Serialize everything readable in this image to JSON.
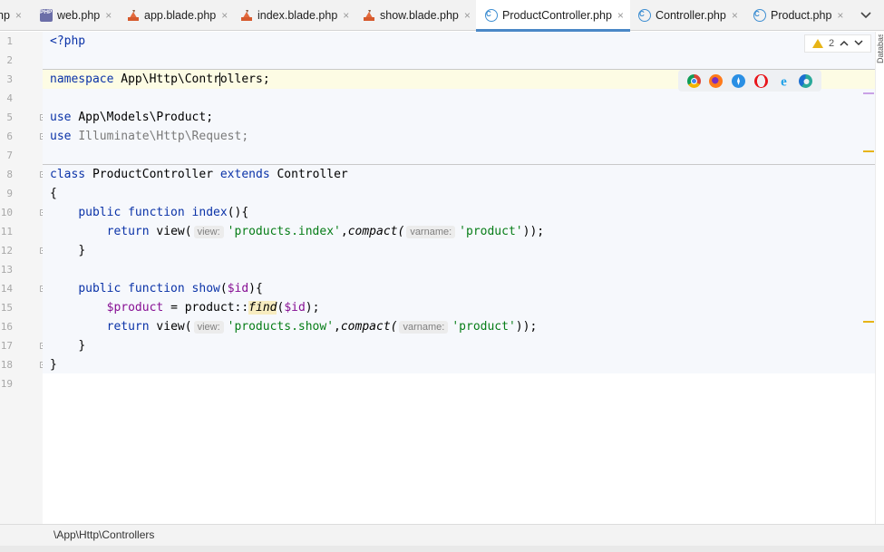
{
  "tabs": [
    {
      "label": "hp",
      "icon": "php-file-icon",
      "active": false
    },
    {
      "label": "web.php",
      "icon": "php-file-icon",
      "active": false
    },
    {
      "label": "app.blade.php",
      "icon": "blade-file-icon",
      "active": false
    },
    {
      "label": "index.blade.php",
      "icon": "blade-file-icon",
      "active": false
    },
    {
      "label": "show.blade.php",
      "icon": "blade-file-icon",
      "active": false
    },
    {
      "label": "ProductController.php",
      "icon": "class-icon",
      "active": true
    },
    {
      "label": "Controller.php",
      "icon": "class-icon",
      "active": false
    },
    {
      "label": "Product.php",
      "icon": "class-icon",
      "active": false
    }
  ],
  "tab_close_glyph": "×",
  "php_badge": "PHP",
  "class_badge": "C",
  "inspection": {
    "warning_count": "2",
    "icon": "warning-icon"
  },
  "line_numbers": [
    "1",
    "2",
    "3",
    "4",
    "5",
    "6",
    "7",
    "8",
    "9",
    "10",
    "11",
    "12",
    "13",
    "14",
    "15",
    "16",
    "17",
    "18",
    "19"
  ],
  "code": {
    "l1": "<?php",
    "l3_kw": "namespace",
    "l3_pre": "App\\Http\\Contr",
    "l3_post": "ollers",
    "l3_end": ";",
    "l5_kw": "use",
    "l5_rest": "App\\Models\\Product;",
    "l6_kw": "use",
    "l6_rest": "Illuminate\\Http\\Request;",
    "l8_kw1": "class",
    "l8_name": "ProductController",
    "l8_kw2": "extends",
    "l8_parent": "Controller",
    "l9": "{",
    "l10_kw": "public function",
    "l10_fn": "index",
    "l10_end": "(){",
    "l11_kw": "return",
    "l11_fn": "view(",
    "l11_hint1": "view:",
    "l11_str1": "'products.index'",
    "l11_comma": ",",
    "l11_compact": "compact(",
    "l11_hint2": "varname:",
    "l11_str2": "'product'",
    "l11_end": "));",
    "l12": "}",
    "l14_kw": "public function",
    "l14_fn": "show",
    "l14_open": "(",
    "l14_var": "$id",
    "l14_end": "){",
    "l15_var": "$product",
    "l15_mid": " = product::",
    "l15_find": "find",
    "l15_open": "(",
    "l15_var2": "$id",
    "l15_end": ");",
    "l16_kw": "return",
    "l16_fn": "view(",
    "l16_hint1": "view:",
    "l16_str1": "'products.show'",
    "l16_comma": ",",
    "l16_compact": "compact(",
    "l16_hint2": "varname:",
    "l16_str2": "'product'",
    "l16_end": "));",
    "l17": "}",
    "l18": "}"
  },
  "browsers": [
    {
      "name": "chrome-icon",
      "color": "#e0412f"
    },
    {
      "name": "firefox-icon",
      "color": "#ff7a1a"
    },
    {
      "name": "safari-icon",
      "color": "#2a8fe4"
    },
    {
      "name": "opera-icon",
      "color": "#e8161c"
    },
    {
      "name": "ie-icon",
      "color": "#1ea0e8"
    },
    {
      "name": "edge-icon",
      "color": "#2aa99a"
    }
  ],
  "side_panel_label": "Database",
  "breadcrumb": "\\App\\Http\\Controllers",
  "colors": {
    "accent": "#4a88c7",
    "keyword": "#0b33a8",
    "string": "#067d17",
    "variable": "#871094",
    "warning": "#e7b416"
  }
}
